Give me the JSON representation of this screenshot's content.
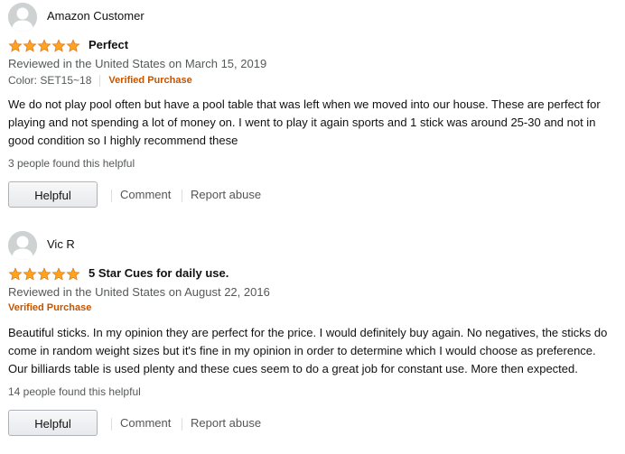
{
  "colors": {
    "star": "#ffa41c",
    "verified": "#c45500",
    "muted_text": "#565959"
  },
  "reviews": [
    {
      "author": "Amazon Customer",
      "rating": 5,
      "title": "Perfect",
      "date": "Reviewed in the United States on March 15, 2019",
      "variant": "Color: SET15~18",
      "verified": "Verified Purchase",
      "body": "We do not play pool often but have a pool table that was left when we moved into our house. These are perfect for playing and not spending a lot of money on. I went to play it again sports and 1 stick was around 25-30 and not in good condition so I highly recommend these",
      "helpful_count": "3 people found this helpful",
      "helpful_button": "Helpful",
      "comment_link": "Comment",
      "report_link": "Report abuse"
    },
    {
      "author": "Vic R",
      "rating": 5,
      "title": "5 Star Cues for daily use.",
      "date": "Reviewed in the United States on August 22, 2016",
      "verified": "Verified Purchase",
      "body": "Beautiful sticks. In my opinion they are perfect for the price. I would definitely buy again. No negatives, the sticks do come in random weight sizes but it's fine in my opinion in order to determine which I would choose as preference. Our billiards table is used plenty and these cues seem to do a great job for constant use. More then expected.",
      "helpful_count": "14 people found this helpful",
      "helpful_button": "Helpful",
      "comment_link": "Comment",
      "report_link": "Report abuse"
    }
  ]
}
